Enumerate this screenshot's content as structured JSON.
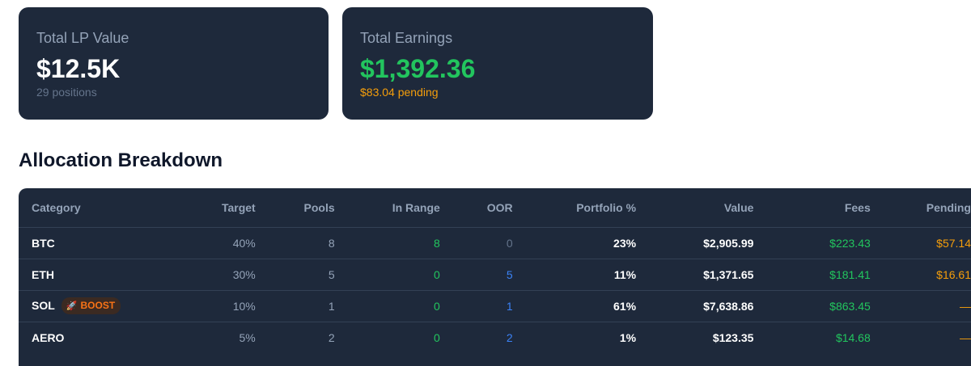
{
  "cards": {
    "lp": {
      "label": "Total LP Value",
      "value": "$12.5K",
      "sub": "29 positions"
    },
    "earnings": {
      "label": "Total Earnings",
      "value": "$1,392.36",
      "sub": "$83.04 pending"
    }
  },
  "allocation": {
    "title": "Allocation Breakdown",
    "columns": {
      "category": "Category",
      "target": "Target",
      "pools": "Pools",
      "in_range": "In Range",
      "oor": "OOR",
      "portfolio": "Portfolio %",
      "value": "Value",
      "fees": "Fees",
      "pending": "Pending"
    },
    "rows": [
      {
        "category": "BTC",
        "target": "40%",
        "pools": "8",
        "in_range": "8",
        "oor": "0",
        "portfolio": "23%",
        "value": "$2,905.99",
        "fees": "$223.43",
        "pending": "$57.14"
      },
      {
        "category": "ETH",
        "target": "30%",
        "pools": "5",
        "in_range": "0",
        "oor": "5",
        "portfolio": "11%",
        "value": "$1,371.65",
        "fees": "$181.41",
        "pending": "$16.61"
      },
      {
        "category": "SOL",
        "badge": "BOOST",
        "badge_icon": "rocket-icon",
        "target": "10%",
        "pools": "1",
        "in_range": "0",
        "oor": "1",
        "portfolio": "61%",
        "value": "$7,638.86",
        "fees": "$863.45",
        "pending": "—"
      },
      {
        "category": "AERO",
        "target": "5%",
        "pools": "2",
        "in_range": "0",
        "oor": "2",
        "portfolio": "1%",
        "value": "$123.35",
        "fees": "$14.68",
        "pending": "—"
      }
    ]
  },
  "colors": {
    "card_bg": "#1e293b",
    "positive": "#22c55e",
    "pending": "#f59e0b",
    "oor": "#3b82f6",
    "boost": "#f97316"
  }
}
